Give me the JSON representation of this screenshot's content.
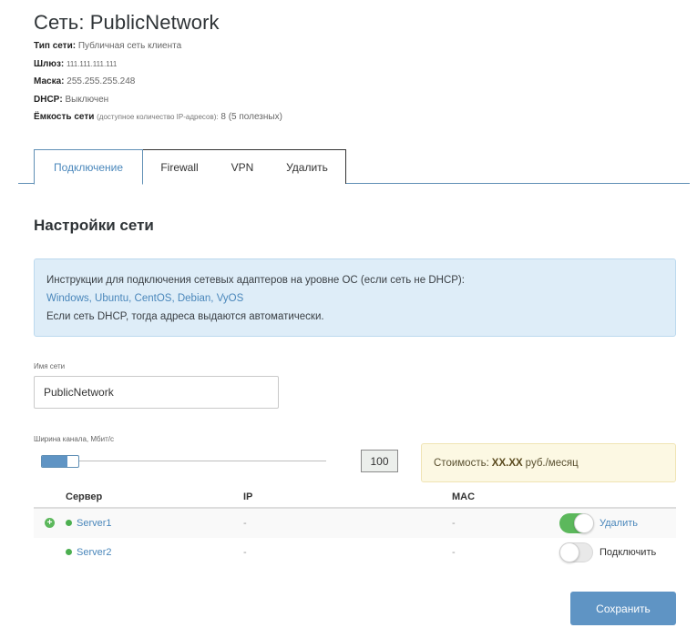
{
  "header": {
    "title": "Сеть: PublicNetwork",
    "network_type_label": "Тип сети:",
    "network_type_value": "Публичная сеть клиента",
    "gateway_label": "Шлюз:",
    "gateway_value": "111.111.111.111",
    "mask_label": "Маска:",
    "mask_value": "255.255.255.248",
    "dhcp_label": "DHCP:",
    "dhcp_value": "Выключен",
    "capacity_label": "Ёмкость сети",
    "capacity_note": "(доступное количество IP-адресов):",
    "capacity_value": "8 (5 полезных)"
  },
  "tabs": [
    {
      "label": "Подключение",
      "active": true
    },
    {
      "label": "Firewall",
      "active": false
    },
    {
      "label": "VPN",
      "active": false
    },
    {
      "label": "Удалить",
      "active": false
    }
  ],
  "section_title": "Настройки сети",
  "info": {
    "line1": "Инструкции для подключения сетевых адаптеров на уровне ОС (если сеть не DHCP):",
    "links": [
      "Windows",
      "Ubuntu",
      "CentOS",
      "Debian",
      "VyOS"
    ],
    "line3": "Если сеть DHCP, тогда адреса выдаются автоматически."
  },
  "name_field": {
    "label": "Имя сети",
    "value": "PublicNetwork"
  },
  "bandwidth": {
    "label": "Ширина канала, Мбит/с",
    "value": "100",
    "slider_fraction": 0.1
  },
  "cost": {
    "label": "Стоимость:",
    "amount": "XX.XX",
    "unit": "руб./месяц"
  },
  "table": {
    "headers": [
      "Сервер",
      "IP",
      "MAC"
    ],
    "rows": [
      {
        "server": "Server1",
        "ip": "-",
        "mac": "-",
        "toggle_on": true,
        "action": "Удалить"
      },
      {
        "server": "Server2",
        "ip": "-",
        "mac": "-",
        "toggle_on": false,
        "action": "Подключить"
      }
    ]
  },
  "save_label": "Сохранить",
  "colors": {
    "accent": "#5f94c4",
    "link": "#4a87bb",
    "toggle_on": "#5cb85c",
    "status_dot": "#4caf50",
    "info_bg": "#deedf8",
    "cost_bg": "#fcf8e3"
  }
}
